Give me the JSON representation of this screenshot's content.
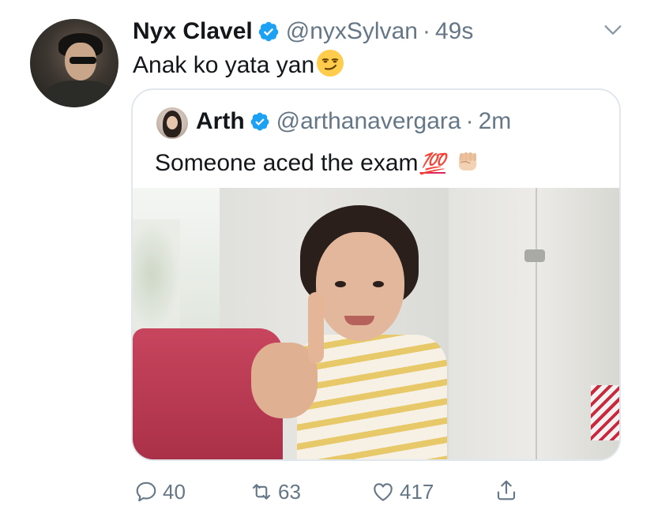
{
  "tweet": {
    "author_name": "Nyx Clavel",
    "handle": "@nyxSylvan",
    "time": "49s",
    "separator": "·",
    "text": "Anak ko yata yan",
    "emoji": "smirking-face",
    "verified": true
  },
  "quoted_tweet": {
    "author_name": "Arth",
    "handle": "@arthanavergara",
    "time": "2m",
    "separator": "·",
    "text": "Someone aced the exam",
    "emoji_100": "💯",
    "emoji_fist": "raised-fist",
    "verified": true
  },
  "actions": {
    "replies": "40",
    "retweets": "63",
    "likes": "417"
  },
  "colors": {
    "verified_blue": "#1da1f2",
    "secondary_text": "#657786",
    "border": "#e1e8ed"
  }
}
